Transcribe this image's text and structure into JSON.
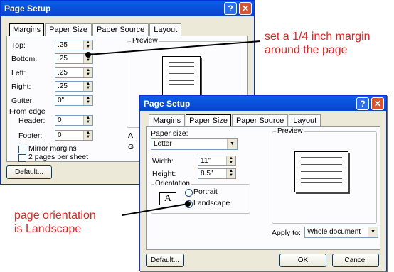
{
  "margins_dialog": {
    "title": "Page Setup",
    "tabs": [
      "Margins",
      "Paper Size",
      "Paper Source",
      "Layout"
    ],
    "fields": [
      {
        "label": "Top:",
        "value": ".25"
      },
      {
        "label": "Bottom:",
        "value": ".25"
      },
      {
        "label": "Left:",
        "value": ".25"
      },
      {
        "label": "Right:",
        "value": ".25"
      },
      {
        "label": "Gutter:",
        "value": "0\""
      }
    ],
    "from_edge_label": "From edge",
    "header": {
      "label": "Header:",
      "value": "0"
    },
    "footer": {
      "label": "Footer:",
      "value": "0"
    },
    "mirror_margins": "Mirror margins",
    "two_pages": "2 pages per sheet",
    "preview_label": "Preview",
    "apply_partial": "A",
    "gutter_partial": "G",
    "default_button": "Default..."
  },
  "paper_dialog": {
    "title": "Page Setup",
    "tabs": [
      "Margins",
      "Paper Size",
      "Paper Source",
      "Layout"
    ],
    "paper_size_label": "Paper size:",
    "paper_size_value": "Letter",
    "width": {
      "label": "Width:",
      "value": "11\""
    },
    "height": {
      "label": "Height:",
      "value": "8.5\""
    },
    "orientation_label": "Orientation",
    "portrait": "Portrait",
    "landscape": "Landscape",
    "orientation_icon_letter": "A",
    "preview_label": "Preview",
    "apply_to_label": "Apply to:",
    "apply_to_value": "Whole document",
    "default_button": "Default...",
    "ok_button": "OK",
    "cancel_button": "Cancel"
  },
  "annotations": {
    "margin_note_line1": "set a 1/4 inch margin",
    "margin_note_line2": "around the page",
    "orientation_note_line1": "page orientation",
    "orientation_note_line2": "is Landscape"
  },
  "colors": {
    "annotation": "#e8211f",
    "titlebar": "#0a5ee8"
  }
}
